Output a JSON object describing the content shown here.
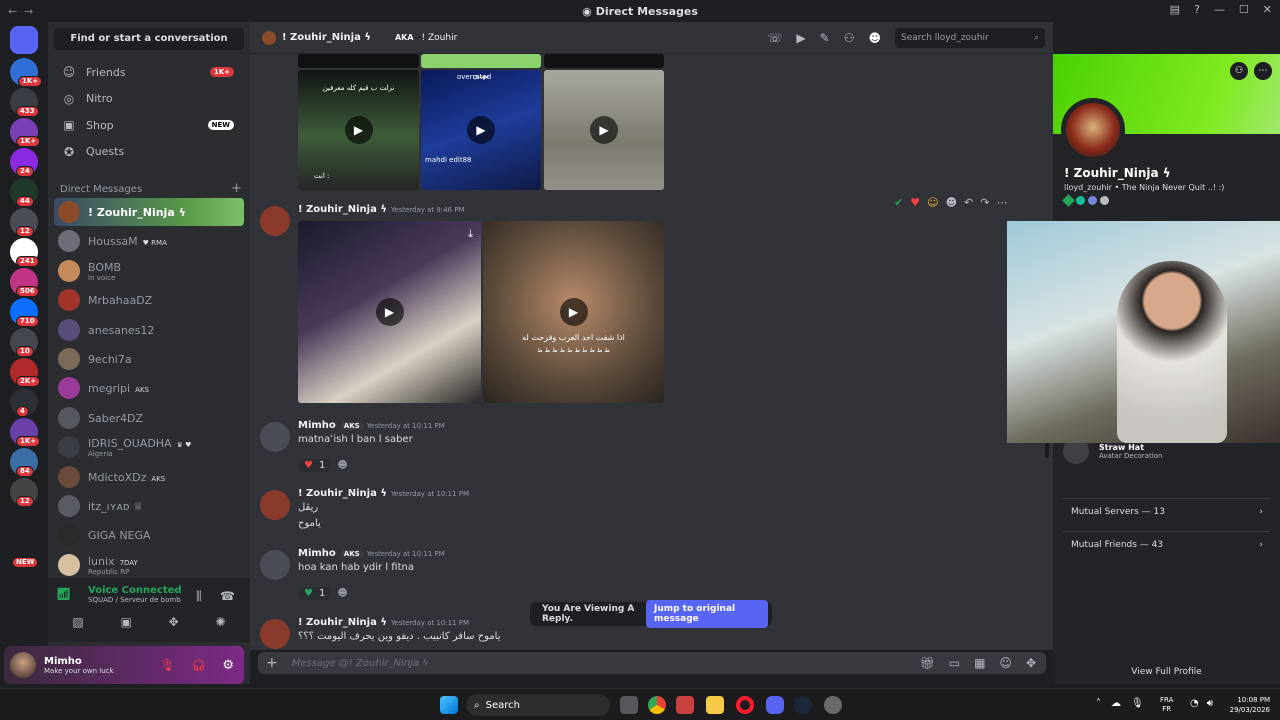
{
  "window": {
    "title": "Direct Messages",
    "back": "←",
    "forward": "→"
  },
  "guild_badges": [
    "1K+",
    "433",
    "1K+",
    "24",
    "44",
    "12",
    "241",
    "506",
    "710",
    "10",
    "2K+",
    "4",
    "1K+",
    "84",
    "12"
  ],
  "guild_new": "NEW",
  "sidebar": {
    "find": "Find or start a conversation",
    "nav": [
      {
        "label": "Friends",
        "badge": "1K+"
      },
      {
        "label": "Nitro",
        "badge": ""
      },
      {
        "label": "Shop",
        "badge": "NEW"
      },
      {
        "label": "Quests",
        "badge": ""
      }
    ],
    "dm_header": "Direct Messages",
    "dms": [
      {
        "name": "! Zouhir_Ninja ϟ",
        "badge": "",
        "sub": ""
      },
      {
        "name": "HoussaM",
        "badge": "♥ RMA",
        "sub": ""
      },
      {
        "name": "BOMB",
        "badge": "",
        "sub": "In voice"
      },
      {
        "name": "MrbahaaDZ",
        "badge": "",
        "sub": ""
      },
      {
        "name": "anesanes12",
        "badge": "",
        "sub": ""
      },
      {
        "name": "9echi7a",
        "badge": "",
        "sub": ""
      },
      {
        "name": "megripi",
        "badge": "AKS",
        "sub": ""
      },
      {
        "name": "Saber4DZ",
        "badge": "",
        "sub": ""
      },
      {
        "name": "IDRIS_OUADHA",
        "badge": "♛ ♥",
        "sub": "Algeria"
      },
      {
        "name": "MdictoXDz",
        "badge": "AKS",
        "sub": ""
      },
      {
        "name": "itz_ıʏᴀᴅ ♕",
        "badge": "",
        "sub": ""
      },
      {
        "name": "GIGA NEGA",
        "badge": "",
        "sub": ""
      },
      {
        "name": "lunix",
        "badge": "7DAY",
        "sub": "Republic RP"
      }
    ]
  },
  "voice": {
    "status": "Voice Connected",
    "channel": "SQUAD / Serveur de bomb"
  },
  "user": {
    "name": "Mimho",
    "status": "Make your own luck"
  },
  "header": {
    "name": "! Zouhir_Ninja ϟ",
    "aka_label": "AKA",
    "aka_value": "! Zouhir",
    "search_placeholder": "Search lloyd_zouhir"
  },
  "thumb_texts": {
    "t1_top": "نزلت ب قيم كله معرفين",
    "t1_bottom": "انت :",
    "t2_top": "overrated",
    "t2_tag": "مهدي",
    "t2_bottom": "mahdi edit88",
    "t3_overlay": "اذا شفت احد العرب وفرحت له",
    "t3_sub": "ط ط ط ط ط ط ط ط ط ط"
  },
  "messages": [
    {
      "author": "! Zouhir_Ninja ϟ",
      "tag": "",
      "time": "Yesterday at 9:46 PM",
      "lines": []
    },
    {
      "author": "Mimho",
      "tag": "AKS",
      "time": "Yesterday at 10:11 PM",
      "lines": [
        "matnaʾish l ban l saber"
      ],
      "reaction": {
        "emoji": "♥",
        "count": "1"
      }
    },
    {
      "author": "! Zouhir_Ninja ϟ",
      "tag": "",
      "time": "Yesterday at 10:11 PM",
      "lines": [
        "ريڤل",
        "ياموح"
      ]
    },
    {
      "author": "Mimho",
      "tag": "AKS",
      "time": "Yesterday at 10:11 PM",
      "lines": [
        "hoa kan hab  ydir l fitna"
      ],
      "reaction": {
        "emoji": "♥",
        "count": "1"
      }
    },
    {
      "author": "! Zouhir_Ninja ϟ",
      "tag": "",
      "time": "Yesterday at 10:11 PM",
      "lines": [
        "ياموح سافر كانبيب . ديفو وين يحرف اليومت ؟؟؟"
      ]
    }
  ],
  "reply_banner": {
    "text": "You Are Viewing A Reply.",
    "button": "Jump to original message"
  },
  "composer": {
    "placeholder": "Message @! Zouhir_Ninja ϟ"
  },
  "profile": {
    "name": "! Zouhir_Ninja ϟ",
    "username": "lloyd_zouhir",
    "tagline": "The Ninja Never Quit ..! :)",
    "deco_name": "Straw Hat",
    "deco_label": "Avatar Decoration",
    "mutual_servers": "Mutual Servers — 13",
    "mutual_friends": "Mutual Friends — 43",
    "view_full": "View Full Profile"
  },
  "taskbar": {
    "search": "Search",
    "lang": "FRA",
    "lang2": "FR",
    "time": "10:08 PM",
    "date": "29/03/2026"
  },
  "colors": {
    "accent": "#5865f2",
    "danger": "#da373c",
    "green": "#23a55a",
    "banner": "#57d50c"
  }
}
